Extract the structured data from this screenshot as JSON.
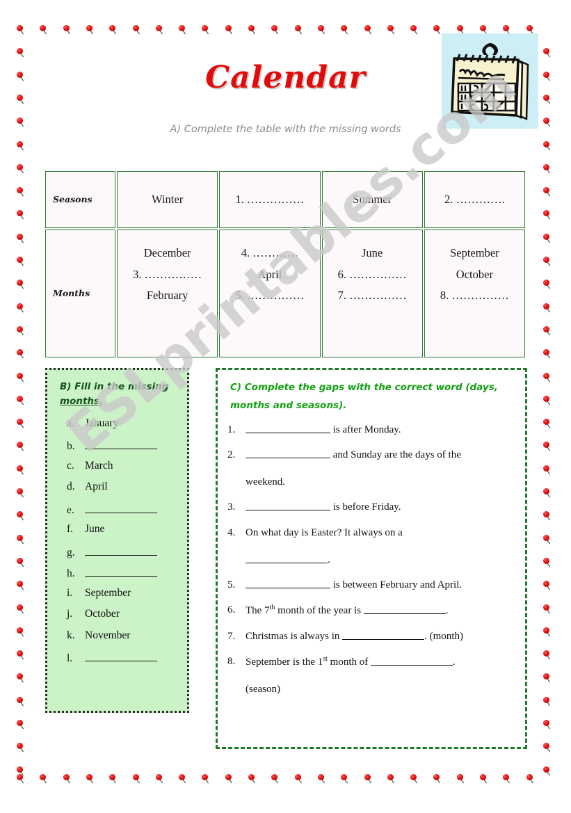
{
  "header": {
    "title": "Calendar",
    "instruction_a": "A) Complete the table with the missing words",
    "clipart_name": "wall-calendar-clipart"
  },
  "watermark": "ESLprintables.com",
  "colors": {
    "title_red": "#e30a0a",
    "table_green": "#2d7a33",
    "box_b_fill": "#ccf2c8",
    "head_b_green": "#16521b",
    "head_c_green": "#12a112",
    "border_berry_red": "#e01010",
    "clipart_bg": "#cdeef4"
  },
  "table": {
    "rows": [
      {
        "label": "Seasons",
        "cells": [
          [
            "Winter"
          ],
          [
            "1.  ……………"
          ],
          [
            "Summer"
          ],
          [
            "2. …………."
          ]
        ]
      },
      {
        "label": "Months",
        "cells": [
          [
            "December",
            "3. ……………",
            "February"
          ],
          [
            "4. …………",
            "April",
            "5. ……………"
          ],
          [
            "June",
            "6. ……………",
            "7. ……………"
          ],
          [
            "September",
            "October",
            "8. ……………"
          ]
        ]
      }
    ]
  },
  "section_b": {
    "heading_line1": "B) Fill in the missing",
    "heading_line2": "months.",
    "items": [
      {
        "marker": "a.",
        "text": "January",
        "blank": false
      },
      {
        "marker": "b.",
        "text": "",
        "blank": true
      },
      {
        "marker": "c.",
        "text": "March",
        "blank": false
      },
      {
        "marker": "d.",
        "text": "April",
        "blank": false
      },
      {
        "marker": "e.",
        "text": "",
        "blank": true
      },
      {
        "marker": "f.",
        "text": "June",
        "blank": false
      },
      {
        "marker": "g.",
        "text": "",
        "blank": true
      },
      {
        "marker": "h.",
        "text": "",
        "blank": true
      },
      {
        "marker": "i.",
        "text": "September",
        "blank": false
      },
      {
        "marker": "j.",
        "text": "October",
        "blank": false
      },
      {
        "marker": "k.",
        "text": "November",
        "blank": false
      },
      {
        "marker": "l.",
        "text": "",
        "blank": true
      }
    ]
  },
  "section_c": {
    "heading_line1": "C) Complete the gaps with the correct word (days,",
    "heading_line2": "months and seasons).",
    "items": [
      {
        "num": "1.",
        "lead": "",
        "after": " is after Monday."
      },
      {
        "num": "2.",
        "lead": "",
        "after": " and Sunday are the days of the",
        "continuation": "weekend."
      },
      {
        "num": "3.",
        "lead": "",
        "after": " is before Friday."
      },
      {
        "num": "4.",
        "lead": "On what day is Easter? It always on a",
        "after": ".",
        "blank_on_second_line": true
      },
      {
        "num": "5.",
        "lead": "",
        "after": " is between February and April."
      },
      {
        "num": "6.",
        "lead": "The 7th month of the year is ",
        "after": ".",
        "sup": "th",
        "lead_pre": "The 7",
        "lead_post": " month of the year is "
      },
      {
        "num": "7.",
        "lead": "Christmas is always in ",
        "after": ". (month)"
      },
      {
        "num": "8.",
        "lead_pre": "September is the 1",
        "sup": "st",
        "lead_post": " month of ",
        "after": ".",
        "continuation": "(season)"
      }
    ]
  }
}
